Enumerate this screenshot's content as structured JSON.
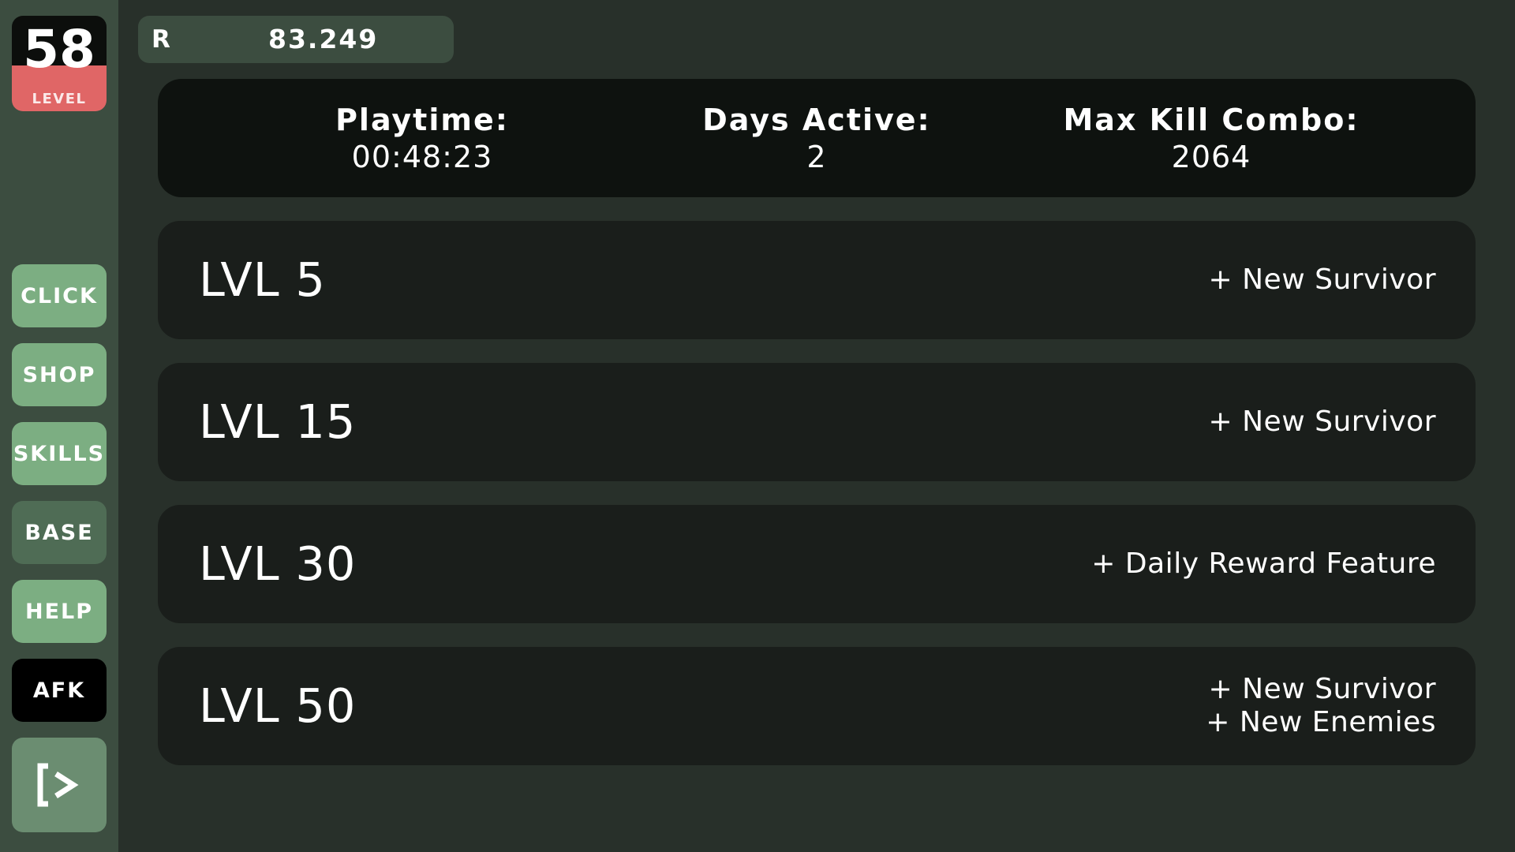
{
  "player": {
    "level": "58",
    "level_label": "LEVEL"
  },
  "nav": [
    {
      "label": "CLICK"
    },
    {
      "label": "SHOP"
    },
    {
      "label": "SKILLS"
    },
    {
      "label": "BASE"
    },
    {
      "label": "HELP"
    },
    {
      "label": "AFK"
    }
  ],
  "exit": {
    "icon": "exit-arrow-icon"
  },
  "currency": {
    "symbol": "R",
    "value": "83.249"
  },
  "stats": {
    "playtime_label": "Playtime:",
    "playtime_value": "00:48:23",
    "days_label": "Days Active:",
    "days_value": "2",
    "combo_label": "Max Kill Combo:",
    "combo_value": "2064"
  },
  "milestones": [
    {
      "level": "LVL 5",
      "rewards": [
        "+ New Survivor"
      ]
    },
    {
      "level": "LVL 15",
      "rewards": [
        "+ New Survivor"
      ]
    },
    {
      "level": "LVL 30",
      "rewards": [
        "+ Daily Reward Feature"
      ]
    },
    {
      "level": "LVL 50",
      "rewards": [
        "+ New Survivor",
        "+ New Enemies"
      ]
    }
  ],
  "colors": {
    "background": "#28302a",
    "sidebar": "#3c4d40",
    "level_accent": "#e06666",
    "nav_button": "#7cae82",
    "nav_button_active": "#4f6c55",
    "nav_afk": "#000000",
    "panel": "#0e120f",
    "card": "#1a1e1b"
  }
}
